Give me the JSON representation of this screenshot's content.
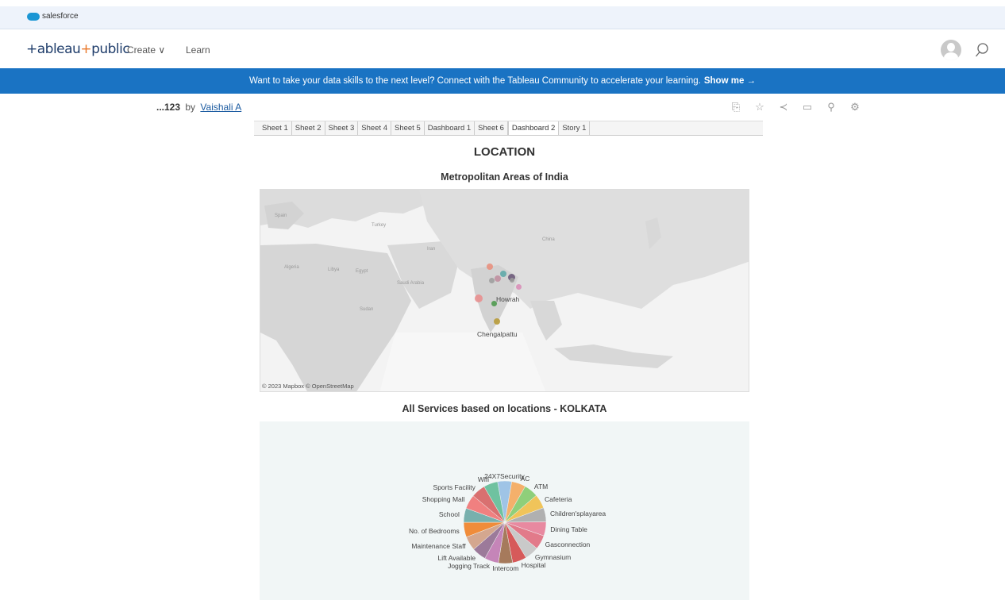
{
  "salesforce": {
    "label": "salesforce"
  },
  "nav": {
    "logo_main": "+ableau",
    "logo_accent": "+",
    "logo_suffix": "public",
    "create": "Create ∨",
    "learn": "Learn"
  },
  "banner": {
    "text": "Want to take your data skills to the next level? Connect with the Tableau Community to accelerate your learning.",
    "cta": "Show me →"
  },
  "viz": {
    "title": "...123",
    "by": "by",
    "author": "Vaishali A",
    "tabs": [
      "Sheet 1",
      "Sheet 2",
      "Sheet 3",
      "Sheet 4",
      "Sheet 5",
      "Dashboard 1",
      "Sheet 6",
      "Dashboard 2",
      "Story 1"
    ],
    "active_tab": "Dashboard 2"
  },
  "dashboard": {
    "title": "LOCATION",
    "map_title": "Metropolitan Areas of India",
    "pie_title": "All Services based on locations - KOLKATA"
  },
  "map": {
    "credit": "© 2023 Mapbox © OpenStreetMap",
    "labels": {
      "howrah": "Howrah",
      "chengalpattu": "Chengalpattu"
    },
    "regions": {
      "turkey": "Turkey",
      "china": "China",
      "algeria": "Algeria",
      "libya": "Libya",
      "egypt": "Egypt",
      "saudi": "Saudi Arabia",
      "iran": "Iran",
      "sudan": "Sudan"
    },
    "points": [
      {
        "color": "#e8907e"
      },
      {
        "color": "#5fa8a8"
      },
      {
        "color": "#9e9e9e"
      },
      {
        "color": "#c08fa0"
      },
      {
        "color": "#6d5a7a"
      },
      {
        "color": "#d98fb8"
      },
      {
        "color": "#e88f8f"
      },
      {
        "color": "#4f9a4f"
      },
      {
        "color": "#b89b3a"
      },
      {
        "color": "#9a9a9a"
      }
    ]
  },
  "chart_data": {
    "type": "pie",
    "title": "All Services based on locations - KOLKATA",
    "categories": [
      "24X7Security",
      "AC",
      "ATM",
      "Cafeteria",
      "Children'splayarea",
      "Dining Table",
      "Gasconnection",
      "Gymnasium",
      "Hospital",
      "Intercom",
      "Jogging Track",
      "Lift Available",
      "Maintenance Staff",
      "No. of Bedrooms",
      "School",
      "Shopping Mall",
      "Sports Facility",
      "Wifi"
    ],
    "values": [
      5.5,
      5.5,
      5.5,
      5.5,
      5.5,
      5.5,
      5.5,
      5.5,
      5.5,
      5.5,
      5.5,
      5.5,
      5.5,
      5.8,
      5.5,
      5.5,
      5.5,
      5.5
    ],
    "colors": [
      "#9fc4e6",
      "#f4b06b",
      "#8fcf7a",
      "#f0c45a",
      "#b0b0b0",
      "#e889a0",
      "#e27a8a",
      "#c9c9c9",
      "#d65a5a",
      "#a67a5c",
      "#c585b8",
      "#9c7a9a",
      "#d4a78f",
      "#f08c3a",
      "#78b0ad",
      "#f08080",
      "#d97070",
      "#6fc2a0"
    ]
  }
}
